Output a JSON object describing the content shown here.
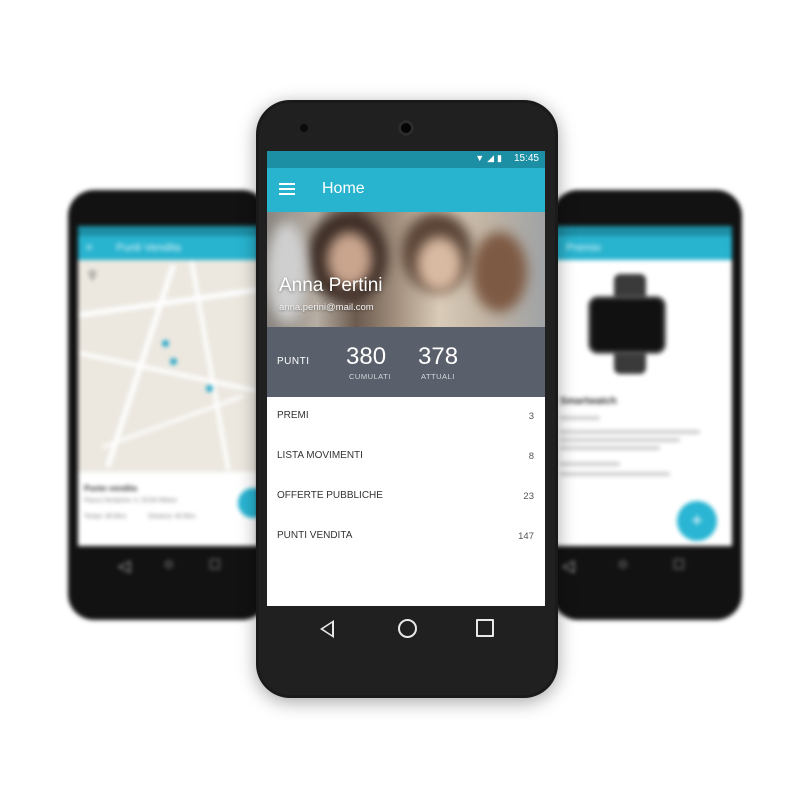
{
  "main": {
    "status": {
      "time": "15:45",
      "icons": "▼◢▮"
    },
    "app_bar": {
      "title": "Home"
    },
    "profile": {
      "name": "Anna Pertini",
      "email": "anna.perini@mail.com"
    },
    "points": {
      "label": "PUNTI",
      "cumulated_value": "380",
      "cumulated_label": "CUMULATI",
      "current_value": "378",
      "current_label": "ATTUALI"
    },
    "menu": [
      {
        "label": "PREMI",
        "count": "3"
      },
      {
        "label": "LISTA MOVIMENTI",
        "count": "8"
      },
      {
        "label": "OFFERTE PUBBLICHE",
        "count": "23"
      },
      {
        "label": "PUNTI VENDITA",
        "count": "147"
      }
    ]
  },
  "left_phone": {
    "title": "Punti Vendita",
    "place_title": "Punto vendita",
    "address": "Piazza Sempione, 4, 20154 Milano",
    "time_label": "Tempo: 48 Mins",
    "distance_label": "Distanza: 48 Mins"
  },
  "right_phone": {
    "title": "Premio",
    "product": "Smartwatch",
    "fab_symbol": "+"
  },
  "colors": {
    "primary": "#28b3cf",
    "primary_dark": "#1d8fa5",
    "points_bg": "#59606b"
  }
}
